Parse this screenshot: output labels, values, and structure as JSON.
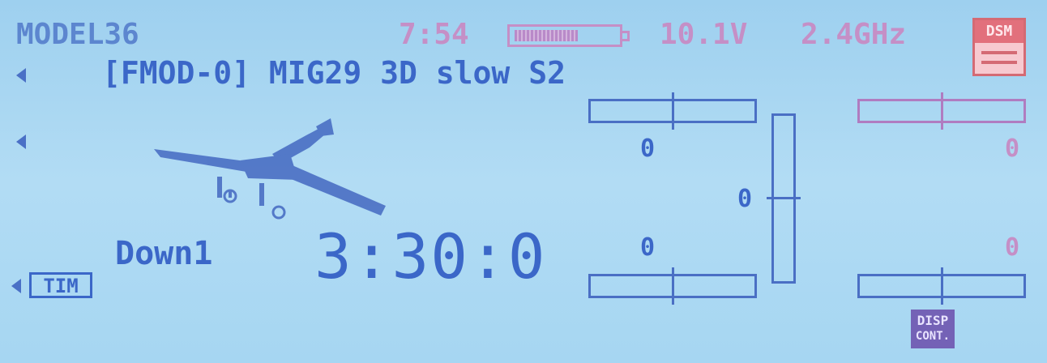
{
  "status": {
    "model_name": "MODEL36",
    "time": "7:54",
    "voltage": "10.1V",
    "band": "2.4GHz",
    "battery_level": 0.6,
    "dsm_badge": "DSM"
  },
  "flight_mode_line": "[FMOD-0] MIG29 3D slow S2",
  "timer": {
    "badge_label": "TIM",
    "mode_label": "Down1",
    "value": "3:30:0"
  },
  "trims": {
    "top_left": "0",
    "top_right": "0",
    "bottom_left": "0",
    "bottom_right": "0",
    "center_vertical": "0"
  },
  "disp_cont": {
    "line1": "DISP",
    "line2": "CONT."
  },
  "colors": {
    "lcd_background": "#9fd0f0",
    "lcd_text": "#3b67c8",
    "pink_text": "#c58fc6",
    "badge": "#7462b6"
  },
  "icons": [
    "left-arrow-icon",
    "airplane-icon",
    "battery-icon",
    "dsm-icon"
  ]
}
